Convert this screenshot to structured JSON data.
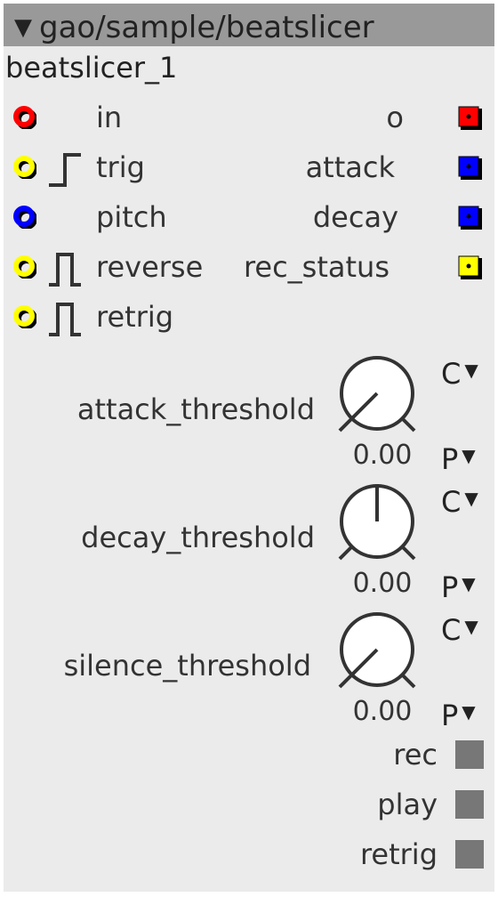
{
  "object": {
    "title": "gao/sample/beatslicer",
    "instance_name": "beatslicer_1",
    "collapse_icon": "triangle-down-icon"
  },
  "colors": {
    "audio": "#ff0000",
    "bool": "#ffff00",
    "frac": "#0000ff",
    "toggle": "#777777",
    "titlebar": "#999999",
    "panel": "#ebebeb"
  },
  "inlets": [
    {
      "label": "in",
      "type": "audio"
    },
    {
      "label": "trig",
      "type": "bool",
      "icon": "rising-edge-icon"
    },
    {
      "label": "pitch",
      "type": "frac"
    },
    {
      "label": "reverse",
      "type": "bool",
      "icon": "pulse-icon"
    },
    {
      "label": "retrig",
      "type": "bool",
      "icon": "pulse-icon"
    }
  ],
  "outlets": [
    {
      "label": "o",
      "type": "audio"
    },
    {
      "label": "attack",
      "type": "frac"
    },
    {
      "label": "decay",
      "type": "frac"
    },
    {
      "label": "rec_status",
      "type": "bool"
    }
  ],
  "params": [
    {
      "label": "attack_threshold",
      "value": "0.00",
      "menu_top": "C",
      "menu_bottom": "P",
      "knob_fraction": 0.0
    },
    {
      "label": "decay_threshold",
      "value": "0.00",
      "menu_top": "C",
      "menu_bottom": "P",
      "knob_fraction": 0.5
    },
    {
      "label": "silence_threshold",
      "value": "0.00",
      "menu_top": "C",
      "menu_bottom": "P",
      "knob_fraction": 0.0
    }
  ],
  "buttons": [
    {
      "label": "rec"
    },
    {
      "label": "play"
    },
    {
      "label": "retrig"
    }
  ]
}
